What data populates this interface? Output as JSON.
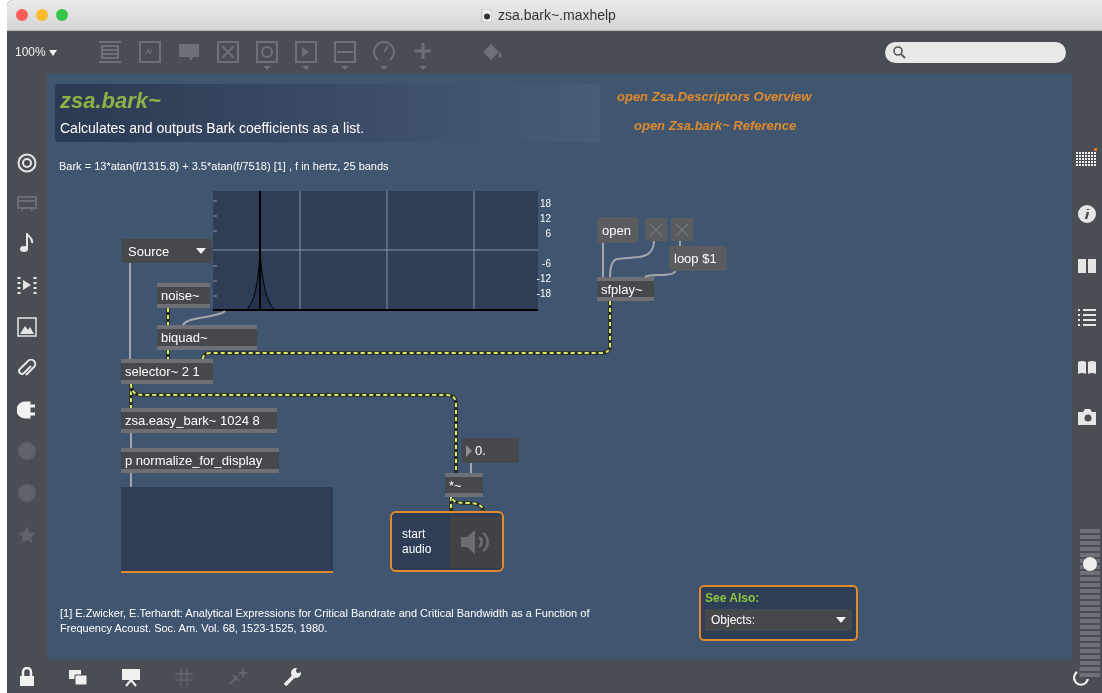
{
  "window": {
    "title": "zsa.bark~.maxhelp"
  },
  "toolbar": {
    "zoom": "100%"
  },
  "header": {
    "title": "zsa.bark~",
    "subtitle": "Calculates and outputs Bark coefficients as a list."
  },
  "links": [
    "open Zsa.Descriptors Overview",
    "open Zsa.bark~ Reference"
  ],
  "formula": "Bark = 13*atan(f/1315.8) + 3.5*atan(f/7518) [1] , f in hertz, 25 bands",
  "filter_graph": {
    "y_labels": [
      "18",
      "12",
      "6",
      "-6",
      "-12",
      "-18"
    ]
  },
  "objects": [
    {
      "kind": "menu",
      "text": "Source"
    },
    {
      "kind": "message",
      "text": "open"
    },
    {
      "kind": "toggle",
      "checked": false
    },
    {
      "kind": "toggle",
      "checked": false
    },
    {
      "kind": "message",
      "text": "loop $1"
    },
    {
      "kind": "object",
      "text": "noise~"
    },
    {
      "kind": "object",
      "text": "sfplay~"
    },
    {
      "kind": "object",
      "text": "biquad~"
    },
    {
      "kind": "object",
      "text": "selector~ 2 1"
    },
    {
      "kind": "object",
      "text": "zsa.easy_bark~ 1024 8"
    },
    {
      "kind": "number",
      "text": "0."
    },
    {
      "kind": "object",
      "text": "p normalize_for_display"
    },
    {
      "kind": "object",
      "text": "*~"
    }
  ],
  "audio_button": {
    "label": "start audio",
    "on": false
  },
  "footnote": "[1] E.Zwicker, E.Terhardt: Analytical Expressions for Critical Bandrate and Critical Bandwidth as a Function of Frequency Acoust. Soc. Am. Vol. 68, 1523-1525, 1980.",
  "see_also": {
    "title": "See Also:",
    "menu": "Objects:"
  },
  "volume": {
    "level": 0.8
  }
}
